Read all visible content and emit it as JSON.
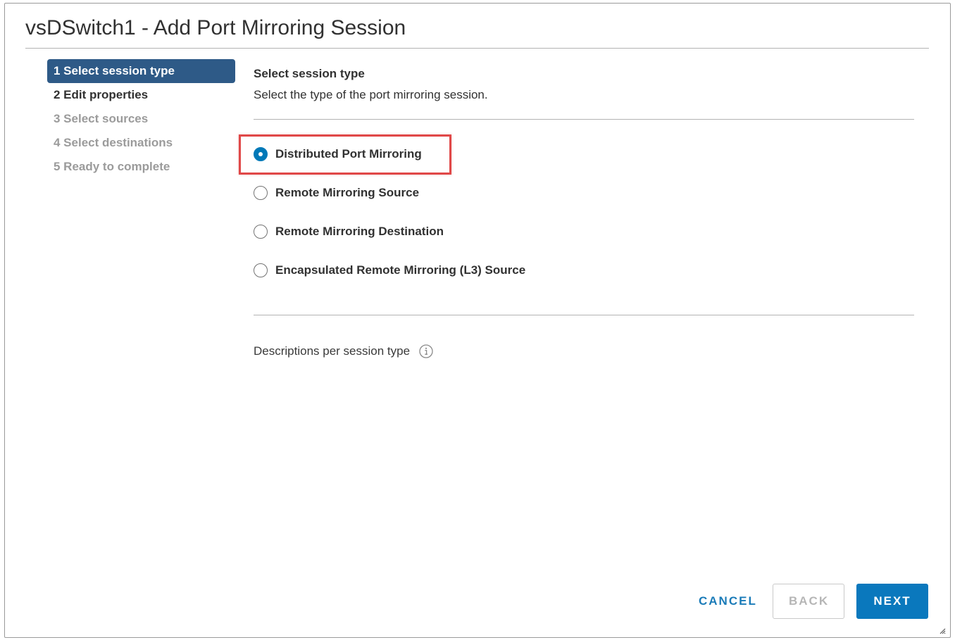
{
  "dialog": {
    "title": "vsDSwitch1 - Add Port Mirroring Session"
  },
  "wizard_steps": [
    {
      "label": "1 Select session type",
      "state": "active"
    },
    {
      "label": "2 Edit properties",
      "state": "enabled"
    },
    {
      "label": "3 Select sources",
      "state": "disabled"
    },
    {
      "label": "4 Select destinations",
      "state": "disabled"
    },
    {
      "label": "5 Ready to complete",
      "state": "disabled"
    }
  ],
  "content": {
    "heading": "Select session type",
    "description": "Select the type of the port mirroring session.",
    "options": [
      {
        "label": "Distributed Port Mirroring",
        "selected": true,
        "highlighted": true
      },
      {
        "label": "Remote Mirroring Source",
        "selected": false
      },
      {
        "label": "Remote Mirroring Destination",
        "selected": false
      },
      {
        "label": "Encapsulated Remote Mirroring (L3) Source",
        "selected": false
      }
    ],
    "descriptions_label": "Descriptions per session type",
    "info_icon": "info-circle-icon"
  },
  "footer": {
    "cancel_label": "CANCEL",
    "back_label": "BACK",
    "next_label": "NEXT",
    "back_enabled": false
  },
  "colors": {
    "active_step_bg": "#2e5a87",
    "primary": "#0a78bd",
    "highlight": "#e04848",
    "disabled_text": "#9b9b9b"
  }
}
